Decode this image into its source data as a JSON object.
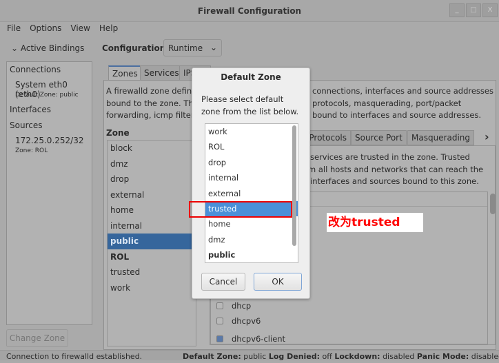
{
  "window": {
    "title": "Firewall Configuration",
    "buttons": [
      "_",
      "□",
      "X"
    ]
  },
  "menu": [
    "File",
    "Options",
    "View",
    "Help"
  ],
  "bindings": {
    "toggle": "Active Bindings",
    "connections_label": "Connections",
    "connection": "System eth0 (eth0)",
    "connection_zone": "Default Zone: public",
    "interfaces_label": "Interfaces",
    "sources_label": "Sources",
    "source": "172.25.0.252/32",
    "source_zone": "Zone: ROL",
    "change_zone": "Change Zone"
  },
  "config": {
    "label": "Configuration:",
    "value": "Runtime"
  },
  "tabs": [
    "Zones",
    "Services",
    "IPS"
  ],
  "zone_desc": [
    "A firewalld zone defines",
    "connections, interfaces and source addresses",
    "bound to the zone. The",
    "protocols, masquerading, port/packet",
    "forwarding, icmp filters",
    "bound to interfaces and source addresses."
  ],
  "zone_header": "Zone",
  "zones": [
    "block",
    "dmz",
    "drop",
    "external",
    "home",
    "internal",
    "public",
    "ROL",
    "trusted",
    "work"
  ],
  "selected_zone": "public",
  "subtabs": [
    "Protocols",
    "Source Port",
    "Masquerading"
  ],
  "trusted_desc": [
    "services are trusted in the zone. Trusted",
    "m all hosts and networks that can reach the",
    "interfaces and sources bound to this zone."
  ],
  "services": [
    {
      "name": "dhcp",
      "checked": false
    },
    {
      "name": "dhcpv6",
      "checked": false
    },
    {
      "name": "dhcpv6-client",
      "checked": true
    }
  ],
  "annotation": "改为trusted",
  "dialog": {
    "title": "Default Zone",
    "prompt_line1": "Please select default",
    "prompt_line2": "zone from the list below.",
    "options": [
      "work",
      "ROL",
      "drop",
      "internal",
      "external",
      "trusted",
      "home",
      "dmz",
      "public"
    ],
    "selected": "trusted",
    "cancel": "Cancel",
    "ok": "OK"
  },
  "status": {
    "message": "Connection to firewalld established.",
    "default_zone_label": "Default Zone:",
    "default_zone": "public",
    "log_denied_label": "Log Denied:",
    "log_denied": "off",
    "lockdown_label": "Lockdown:",
    "lockdown": "disabled",
    "panic_label": "Panic Mode:",
    "panic": "disabled"
  }
}
